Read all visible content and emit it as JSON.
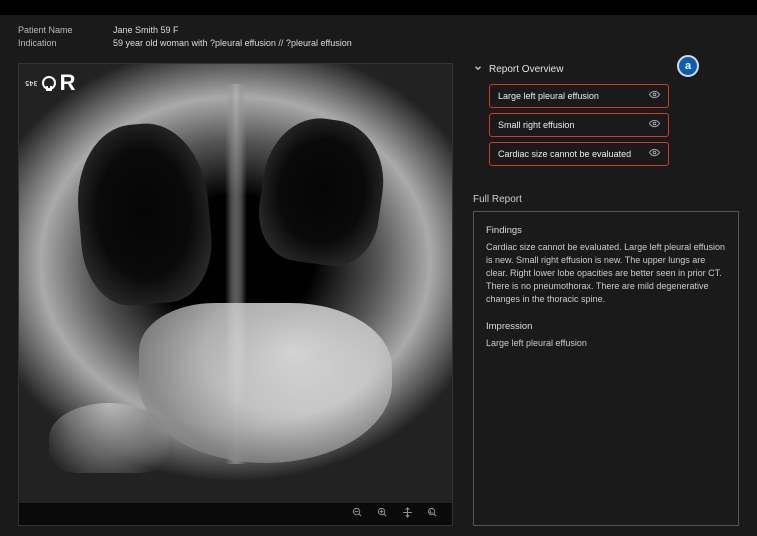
{
  "patient": {
    "name_label": "Patient Name",
    "name_value": "Jane Smith 59 F",
    "indication_label": "Indication",
    "indication_value": "59 year old woman with ?pleural effusion // ?pleural effusion"
  },
  "xray_marker": {
    "number": "345",
    "side": "R"
  },
  "overview": {
    "title": "Report Overview",
    "badge": "a",
    "items": [
      {
        "label": "Large left pleural effusion"
      },
      {
        "label": "Small right effusion"
      },
      {
        "label": "Cardiac size cannot be evaluated"
      }
    ]
  },
  "report": {
    "title": "Full Report",
    "findings_label": "Findings",
    "findings_text": "Cardiac size cannot be evaluated. Large left pleural effusion is new. Small right effusion is new. The upper lungs are clear. Right lower lobe opacities are better seen in prior CT. There is no pneumothorax. There are mild degenerative changes in the thoracic spine.",
    "impression_label": "Impression",
    "impression_text": "Large left pleural effusion"
  },
  "toolbar": {
    "zoom_out": "zoom-out-icon",
    "zoom_in": "zoom-in-icon",
    "pan": "pan-icon",
    "fit": "fit-icon"
  }
}
